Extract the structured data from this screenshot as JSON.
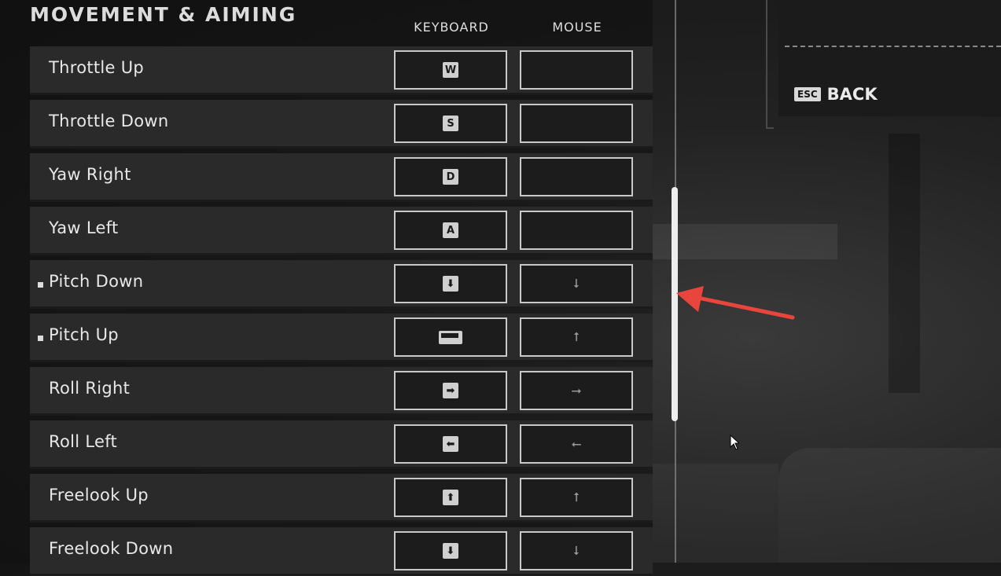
{
  "section": {
    "title": "MOVEMENT & AIMING"
  },
  "columns": {
    "keyboard": "KEYBOARD",
    "mouse": "MOUSE"
  },
  "rows": [
    {
      "label": "Throttle Up",
      "key": "W",
      "key_type": "text",
      "mouse": "",
      "marked": false
    },
    {
      "label": "Throttle Down",
      "key": "S",
      "key_type": "text",
      "mouse": "",
      "marked": false
    },
    {
      "label": "Yaw Right",
      "key": "D",
      "key_type": "text",
      "mouse": "",
      "marked": false
    },
    {
      "label": "Yaw Left",
      "key": "A",
      "key_type": "text",
      "mouse": "",
      "marked": false
    },
    {
      "label": "Pitch Down",
      "key": "down-arrow-key-icon",
      "key_type": "glyph",
      "mouse": "mouse-move-down-icon",
      "marked": true
    },
    {
      "label": "Pitch Up",
      "key": "spacebar-key-icon",
      "key_type": "space",
      "mouse": "mouse-move-up-icon",
      "marked": true
    },
    {
      "label": "Roll Right",
      "key": "right-arrow-key-icon",
      "key_type": "glyph",
      "mouse": "mouse-move-right-icon",
      "marked": false
    },
    {
      "label": "Roll Left",
      "key": "left-arrow-key-icon",
      "key_type": "glyph",
      "mouse": "mouse-move-left-icon",
      "marked": false
    },
    {
      "label": "Freelook Up",
      "key": "up-arrow-key-icon",
      "key_type": "glyph",
      "mouse": "mouse-move-up-icon",
      "marked": false
    },
    {
      "label": "Freelook Down",
      "key": "down-arrow-key-icon",
      "key_type": "glyph",
      "mouse": "mouse-move-down-icon",
      "marked": false
    }
  ],
  "back": {
    "key": "ESC",
    "label": "BACK"
  },
  "colors": {
    "annotation_arrow": "#e8453c",
    "row_bg": "#2a2a2a",
    "border": "#c8c8c8"
  }
}
